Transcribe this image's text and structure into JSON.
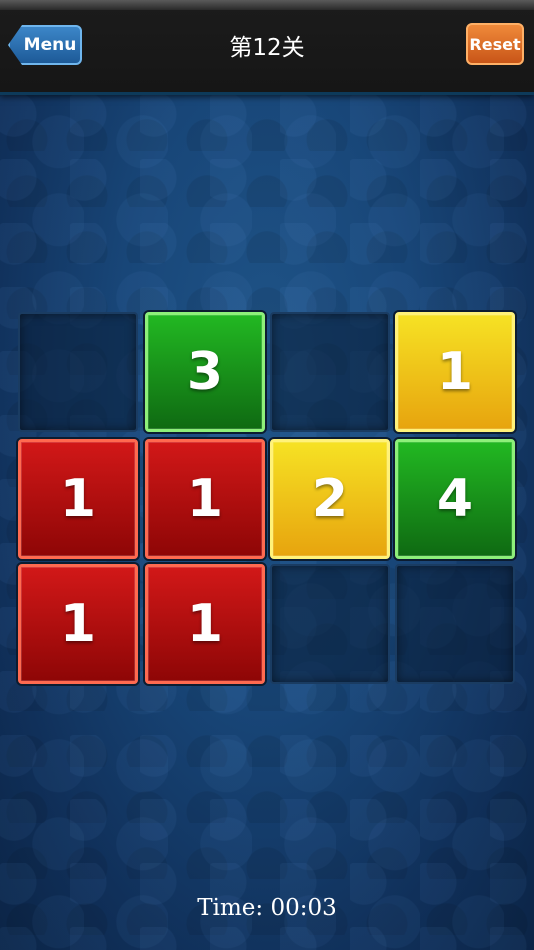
{
  "header": {
    "menu_label": "Menu",
    "title": "第12关",
    "reset_label": "Reset"
  },
  "colors": {
    "red": "#c01010",
    "green": "#1a9a1a",
    "yellow": "#f0c418",
    "accent_blue": "#2b6fb0",
    "reset_orange": "#e06a22"
  },
  "board": {
    "rows": 3,
    "cols": 4,
    "cells": [
      {
        "value": "",
        "color": "empty"
      },
      {
        "value": "3",
        "color": "green"
      },
      {
        "value": "",
        "color": "empty"
      },
      {
        "value": "1",
        "color": "yellow"
      },
      {
        "value": "1",
        "color": "red"
      },
      {
        "value": "1",
        "color": "red"
      },
      {
        "value": "2",
        "color": "yellow"
      },
      {
        "value": "4",
        "color": "green"
      },
      {
        "value": "1",
        "color": "red"
      },
      {
        "value": "1",
        "color": "red"
      },
      {
        "value": "",
        "color": "empty"
      },
      {
        "value": "",
        "color": "empty"
      }
    ]
  },
  "footer": {
    "timer": "Time: 00:03"
  }
}
